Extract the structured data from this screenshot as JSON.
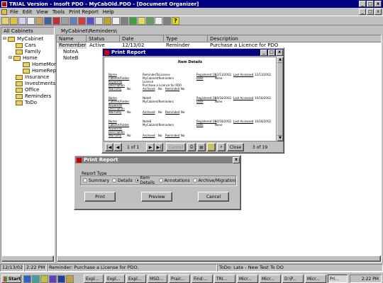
{
  "app": {
    "title": "TRIAL Version - Insoft PDO - MyCabOld.PDO - [Document Organizer]"
  },
  "menu": [
    "File",
    "Edit",
    "View",
    "Tools",
    "Print Report",
    "Help"
  ],
  "left": {
    "header": "All Cabinets",
    "root": "MyCabinet",
    "folders": [
      "Cars",
      "Family",
      "Home",
      "HomeMortga",
      "HomeRepair",
      "Insurance",
      "Investments",
      "Office",
      "Reminders",
      "ToDo"
    ]
  },
  "right": {
    "path": "MyCabinet\\Reminders\\",
    "columns": [
      "Name",
      "Status",
      "Date",
      "Type",
      "Description"
    ],
    "rows": [
      {
        "name": "Remember",
        "status": "Active",
        "date": "12/13/02",
        "type": "Reminder",
        "desc": "Purchase a Licence for PDO"
      },
      {
        "name": "NoteA",
        "status": "",
        "date": "",
        "type": "",
        "desc": ""
      },
      {
        "name": "NoteB",
        "status": "",
        "date": "",
        "type": "",
        "desc": ""
      }
    ]
  },
  "preview": {
    "title": "Print Report",
    "doc_title": "Item Details",
    "blocks": [
      {
        "name": "Name",
        "name_v": "ReminderToLicence",
        "cab": "Cabinet/Folder",
        "cab_v": "MyCabinet/Reminders",
        "key": "Keywords",
        "key_v": "Licence",
        "desc": "Description",
        "desc_v": "Purchase a Licence for PDO",
        "reg": "Registered On",
        "reg_v": "12/13/2002",
        "date": "Date",
        "date_v": "None",
        "last": "Last Accessed",
        "last_v": "12/13/2002",
        "war": "Warranty",
        "war_v": "No",
        "arc": "Archived",
        "arc_v": "No",
        "rem": "Reminded",
        "rem_v": "No"
      },
      {
        "name": "Name",
        "name_v": "NoteA",
        "cab": "Cabinet/Folder",
        "cab_v": "MyCabinet/Reminders",
        "key": "Keywords",
        "key_v": "",
        "desc": "Description",
        "desc_v": "",
        "reg": "Registered On",
        "reg_v": "10/18/2002",
        "date": "Date",
        "date_v": "None",
        "last": "Last Accessed",
        "last_v": "10/18/2002",
        "war": "Warranty",
        "war_v": "No",
        "arc": "Archived",
        "arc_v": "No",
        "rem": "Reminded",
        "rem_v": "No"
      },
      {
        "name": "Name",
        "name_v": "NoteB",
        "cab": "Cabinet/Folder",
        "cab_v": "MyCabinet/Reminders",
        "key": "Keywords",
        "key_v": "",
        "desc": "Description",
        "desc_v": "",
        "reg": "Registered On",
        "reg_v": "10/18/2002",
        "date": "Date",
        "date_v": "None",
        "last": "Last Accessed",
        "last_v": "10/18/2002",
        "war": "Warranty",
        "war_v": "No",
        "arc": "Archived",
        "arc_v": "No",
        "rem": "Reminded",
        "rem_v": "No"
      }
    ],
    "page_label": "1 of 1",
    "cancel": "Cancel",
    "close": "Close",
    "status": "3 of 19"
  },
  "dialog": {
    "title": "Print Report",
    "group": "Report Type",
    "options": [
      "Summary",
      "Details",
      "Item Details",
      "Annotations",
      "Archive/Migration"
    ],
    "selected": 2,
    "print": "Print",
    "preview": "Preview",
    "cancel": "Cancel"
  },
  "status": {
    "date": "12/13/02",
    "time": "2:22 PM",
    "reminder": "Reminder: Purchase a License for PDO.",
    "todo": "ToDo: Late - New Test To DO"
  },
  "taskbar": {
    "start": "Start",
    "tasks": [
      "Expl...",
      "Expl...",
      "Expl...",
      "MSD...",
      "Prair...",
      "Find:...",
      "TRI...",
      "Micr...",
      "Micr...",
      "D:\\P...",
      "Micr...",
      "Pri..."
    ],
    "clock": "2:22 PM"
  }
}
